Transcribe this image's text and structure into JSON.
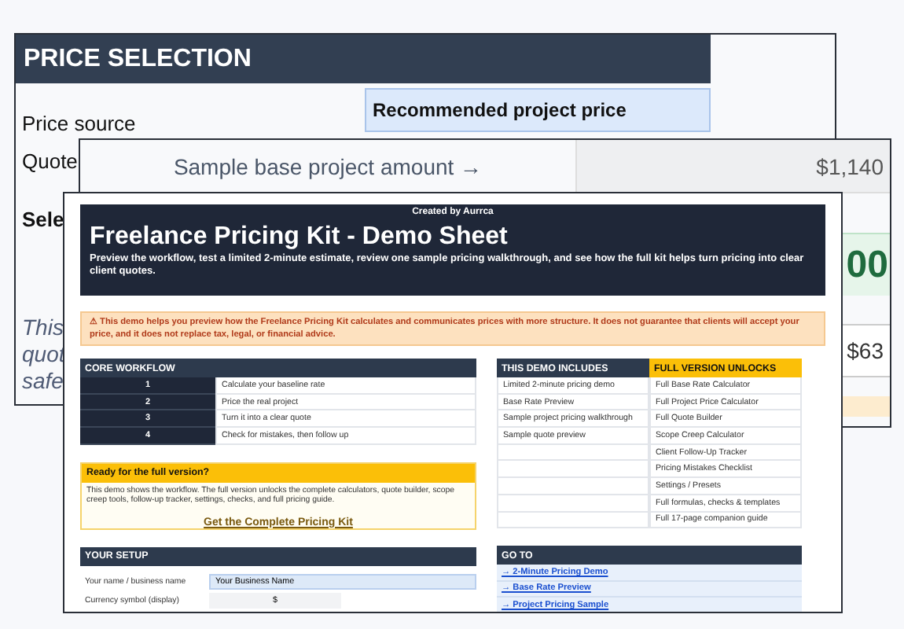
{
  "back_sheet": {
    "title": "PRICE SELECTION",
    "rows": [
      {
        "label": "Price source",
        "value": "Recommended project price",
        "bold": false
      },
      {
        "label": "Quote",
        "bold": false
      },
      {
        "label": "Sele",
        "bold": true
      }
    ],
    "note_lines": [
      "This",
      "quot",
      "safe"
    ]
  },
  "middle_sheet": {
    "amount_label": "Sample base project amount →",
    "amount_value": "$1,140",
    "total_value": "00",
    "fee_value": "$63"
  },
  "front_sheet": {
    "credit": "Created by Aurrca",
    "title": "Freelance Pricing Kit - Demo Sheet",
    "subtitle": "Preview the workflow, test a limited 2-minute estimate, review one sample pricing walkthrough, and see how the full kit helps turn pricing into clear client quotes.",
    "notice": "⚠ This demo helps you preview how the Freelance Pricing Kit calculates and communicates prices with more structure. It does not guarantee that clients will accept your price, and it does not replace tax, legal, or financial advice.",
    "workflow": {
      "title": "CORE WORKFLOW",
      "steps": [
        {
          "number": "1",
          "label": "Calculate your baseline rate"
        },
        {
          "number": "2",
          "label": "Price the real project"
        },
        {
          "number": "3",
          "label": "Turn it into a clear quote"
        },
        {
          "number": "4",
          "label": "Check for mistakes, then follow up"
        }
      ]
    },
    "upgrade": {
      "title": "Ready for the full version?",
      "text": "This demo shows the workflow. The full version unlocks the complete calculators, quote builder, scope creep tools, follow-up tracker, settings, checks, and full pricing guide.",
      "link": "Get the Complete Pricing Kit"
    },
    "setup": {
      "title": "YOUR SETUP",
      "fields": [
        {
          "label": "Your name / business name",
          "value": "Your Business Name",
          "kind": "text"
        },
        {
          "label": "Currency symbol (display)",
          "value": "$",
          "kind": "short"
        }
      ]
    },
    "comparison": {
      "demo_title": "THIS DEMO INCLUDES",
      "full_title": "FULL VERSION UNLOCKS",
      "demo": [
        "Limited 2-minute pricing demo",
        "Base Rate Preview",
        "Sample project pricing walkthrough",
        "Sample quote preview"
      ],
      "full": [
        "Full Base Rate Calculator",
        "Full Project Price Calculator",
        "Full Quote Builder",
        "Scope Creep Calculator",
        "Client Follow-Up Tracker",
        "Pricing Mistakes Checklist",
        "Settings / Presets",
        "Full formulas, checks & templates",
        "Full 17-page companion guide"
      ]
    },
    "goto": {
      "title": "GO TO",
      "links": [
        "→ 2-Minute Pricing Demo",
        "→ Base Rate Preview",
        "→ Project Pricing Sample"
      ]
    }
  }
}
